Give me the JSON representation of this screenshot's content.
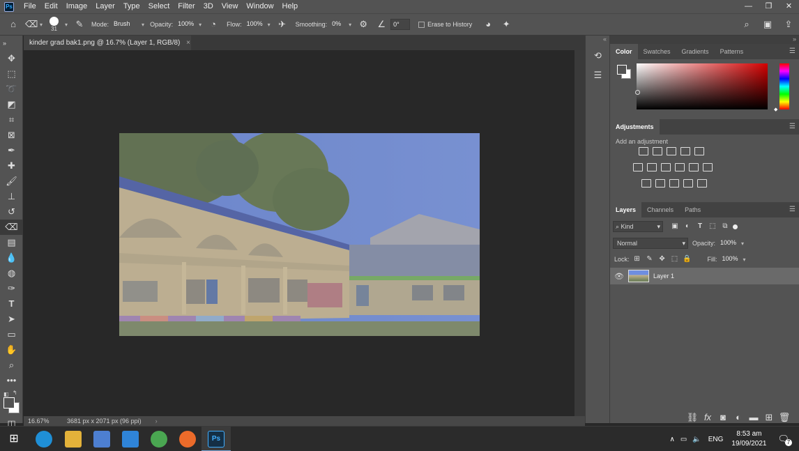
{
  "menubar": {
    "logo": "Ps",
    "items": [
      "File",
      "Edit",
      "Image",
      "Layer",
      "Type",
      "Select",
      "Filter",
      "3D",
      "View",
      "Window",
      "Help"
    ]
  },
  "options": {
    "brush_size": "31",
    "mode_label": "Mode:",
    "mode_value": "Brush",
    "opacity_label": "Opacity:",
    "opacity_value": "100%",
    "flow_label": "Flow:",
    "flow_value": "100%",
    "smoothing_label": "Smoothing:",
    "smoothing_value": "0%",
    "angle_value": "0°",
    "erase_history_label": "Erase to History"
  },
  "document": {
    "tab_title": "kinder grad bak1.png @ 16.7% (Layer 1, RGB/8)",
    "zoom": "16.67%",
    "dimensions": "3681 px x 2071 px (96 ppi)"
  },
  "color_panel": {
    "tabs": [
      "Color",
      "Swatches",
      "Gradients",
      "Patterns"
    ]
  },
  "adjustments_panel": {
    "title": "Adjustments",
    "subtitle": "Add an adjustment"
  },
  "layers_panel": {
    "tabs": [
      "Layers",
      "Channels",
      "Paths"
    ],
    "kind_label": "Kind",
    "blend_mode": "Normal",
    "opacity_label": "Opacity:",
    "opacity_value": "100%",
    "lock_label": "Lock:",
    "fill_label": "Fill:",
    "fill_value": "100%",
    "layers": [
      {
        "name": "Layer 1"
      }
    ]
  },
  "taskbar": {
    "language": "ENG",
    "time": "8:53 am",
    "date": "19/09/2021",
    "notification_count": "7"
  },
  "colors": {
    "ui_panel": "#535353",
    "canvas_bg": "#282828",
    "accent_ps": "#31a8ff"
  }
}
